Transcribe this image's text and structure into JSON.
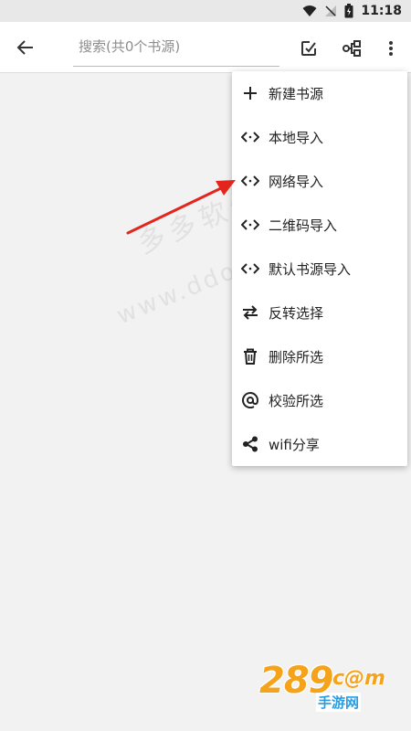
{
  "status_bar": {
    "time": "11:18"
  },
  "toolbar": {
    "search_placeholder": "搜索(共0个书源)"
  },
  "menu": {
    "items": [
      {
        "label": "新建书源",
        "icon": "add-icon"
      },
      {
        "label": "本地导入",
        "icon": "code-icon"
      },
      {
        "label": "网络导入",
        "icon": "code-icon"
      },
      {
        "label": "二维码导入",
        "icon": "code-icon"
      },
      {
        "label": "默认书源导入",
        "icon": "code-icon"
      },
      {
        "label": "反转选择",
        "icon": "swap-icon"
      },
      {
        "label": "删除所选",
        "icon": "trash-icon"
      },
      {
        "label": "校验所选",
        "icon": "at-icon"
      },
      {
        "label": "wifi分享",
        "icon": "share-icon"
      }
    ]
  },
  "watermark": {
    "text": "多多软件站",
    "url": "www.ddooo.com"
  },
  "logo": {
    "number": "289",
    "suffix": "c@m",
    "sub": "手游网"
  },
  "colors": {
    "arrow": "#e3261d",
    "logo_orange": "#f6a31c",
    "logo_blue": "#2b9ce0"
  }
}
